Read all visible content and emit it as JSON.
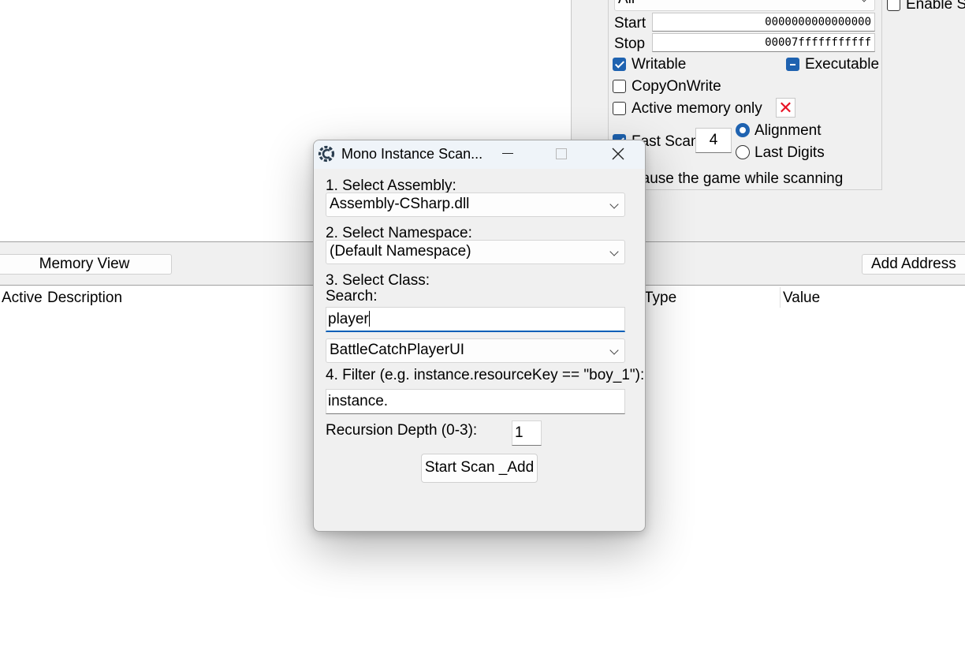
{
  "main_window": {
    "scan_type_value": "All",
    "start_label": "Start",
    "start_value": "0000000000000000",
    "stop_label": "Stop",
    "stop_value": "00007fffffffffff",
    "writable_label": "Writable",
    "writable_checked": true,
    "executable_label": "Executable",
    "executable_state": "indeterminate",
    "copy_on_write_label": "CopyOnWrite",
    "active_memory_label": "Active memory only",
    "fast_scan_label": "Fast Scan",
    "fast_scan_value": "4",
    "alignment_label": "Alignment",
    "last_digits_label": "Last Digits",
    "pause_label": "Pause the game while scanning",
    "enable_speedhack_label": "Enable S",
    "memory_view_button": "Memory View",
    "add_address_button": "Add Address",
    "columns": [
      "Active",
      "Description",
      "Type",
      "Value"
    ]
  },
  "dialog": {
    "title": "Mono Instance Scan...",
    "step1_label": "1. Select Assembly:",
    "assembly_value": "Assembly-CSharp.dll",
    "step2_label": "2. Select Namespace:",
    "namespace_value": "(Default Namespace)",
    "step3_label": "3. Select Class:",
    "search_label": "Search:",
    "search_value": "player",
    "class_value": "BattleCatchPlayerUI",
    "step4_label": "4. Filter (e.g. instance.resourceKey == \"boy_1\"):",
    "filter_value": "instance.",
    "recursion_label": "Recursion Depth (0-3):",
    "recursion_value": "1",
    "start_button": "Start Scan _Add"
  },
  "colors": {
    "accent": "#1e62b0",
    "focus": "#005fb8",
    "error_red": "#e81123",
    "dialog_bg": "#f0f0f0",
    "titlebar_bg": "#eff4f9"
  },
  "icons": [
    "cheat-engine-icon",
    "minimize-icon",
    "maximize-icon",
    "close-icon",
    "chevron-down-icon",
    "red-x-icon"
  ]
}
